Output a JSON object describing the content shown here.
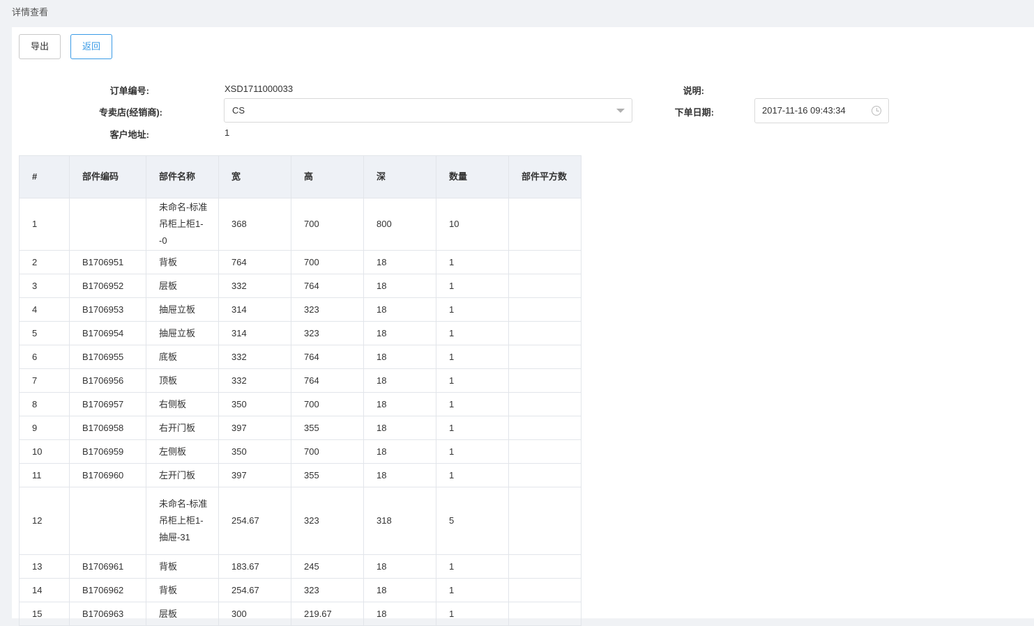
{
  "header": {
    "title": "详情查看"
  },
  "toolbar": {
    "export_label": "导出",
    "back_label": "返回"
  },
  "form": {
    "order_no_label": "订单编号:",
    "order_no": "XSD1711000033",
    "store_label": "专卖店(经销商):",
    "store_value": "CS",
    "address_label": "客户地址:",
    "address_value": "1",
    "note_label": "说明:",
    "note_value": "",
    "date_label": "下单日期:",
    "date_value": "2017-11-16 09:43:34"
  },
  "table": {
    "columns": [
      "#",
      "部件编码",
      "部件名称",
      "宽",
      "高",
      "深",
      "数量",
      "部件平方数"
    ],
    "rows": [
      {
        "idx": "1",
        "code": "",
        "name": "未命名-标准吊柜上柜1--0",
        "w": "368",
        "h": "700",
        "d": "800",
        "qty": "10",
        "area": ""
      },
      {
        "idx": "2",
        "code": "B1706951",
        "name": "背板",
        "w": "764",
        "h": "700",
        "d": "18",
        "qty": "1",
        "area": ""
      },
      {
        "idx": "3",
        "code": "B1706952",
        "name": "层板",
        "w": "332",
        "h": "764",
        "d": "18",
        "qty": "1",
        "area": ""
      },
      {
        "idx": "4",
        "code": "B1706953",
        "name": "抽屉立板",
        "w": "314",
        "h": "323",
        "d": "18",
        "qty": "1",
        "area": ""
      },
      {
        "idx": "5",
        "code": "B1706954",
        "name": "抽屉立板",
        "w": "314",
        "h": "323",
        "d": "18",
        "qty": "1",
        "area": ""
      },
      {
        "idx": "6",
        "code": "B1706955",
        "name": "底板",
        "w": "332",
        "h": "764",
        "d": "18",
        "qty": "1",
        "area": ""
      },
      {
        "idx": "7",
        "code": "B1706956",
        "name": "顶板",
        "w": "332",
        "h": "764",
        "d": "18",
        "qty": "1",
        "area": ""
      },
      {
        "idx": "8",
        "code": "B1706957",
        "name": "右侧板",
        "w": "350",
        "h": "700",
        "d": "18",
        "qty": "1",
        "area": ""
      },
      {
        "idx": "9",
        "code": "B1706958",
        "name": "右开门板",
        "w": "397",
        "h": "355",
        "d": "18",
        "qty": "1",
        "area": ""
      },
      {
        "idx": "10",
        "code": "B1706959",
        "name": "左侧板",
        "w": "350",
        "h": "700",
        "d": "18",
        "qty": "1",
        "area": ""
      },
      {
        "idx": "11",
        "code": "B1706960",
        "name": "左开门板",
        "w": "397",
        "h": "355",
        "d": "18",
        "qty": "1",
        "area": ""
      },
      {
        "idx": "12",
        "code": "",
        "name": "未命名-标准吊柜上柜1-抽屉-31",
        "w": "254.67",
        "h": "323",
        "d": "318",
        "qty": "5",
        "area": ""
      },
      {
        "idx": "13",
        "code": "B1706961",
        "name": "背板",
        "w": "183.67",
        "h": "245",
        "d": "18",
        "qty": "1",
        "area": ""
      },
      {
        "idx": "14",
        "code": "B1706962",
        "name": "背板",
        "w": "254.67",
        "h": "323",
        "d": "18",
        "qty": "1",
        "area": ""
      },
      {
        "idx": "15",
        "code": "B1706963",
        "name": "层板",
        "w": "300",
        "h": "219.67",
        "d": "18",
        "qty": "1",
        "area": ""
      }
    ]
  },
  "colors": {
    "accent": "#3a9be6",
    "header_bg": "#eef1f6",
    "page_bg": "#f0f2f5"
  },
  "icons": {
    "select": "chevron-down-icon",
    "date": "clock-icon"
  }
}
